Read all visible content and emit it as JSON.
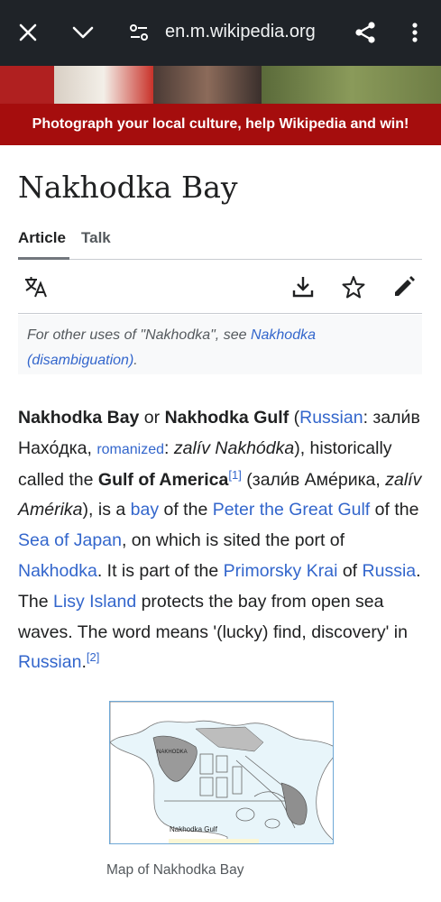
{
  "browser": {
    "url": "en.m.wikipedia.org",
    "icons": [
      "close-icon",
      "chevron-down-icon",
      "site-settings-icon",
      "share-icon",
      "more-vert-icon"
    ]
  },
  "banner": {
    "text": "Photograph your local culture, help Wikipedia and win!",
    "color": "#a50d0d"
  },
  "page": {
    "title": "Nakhodka Bay",
    "tabs": [
      {
        "label": "Article",
        "active": true
      },
      {
        "label": "Talk",
        "active": false
      }
    ],
    "actions": [
      "language-icon",
      "download-icon",
      "watch-star-icon",
      "edit-pencil-icon"
    ]
  },
  "hatnote": {
    "prefix": "For other uses of \"Nakhodka\", see ",
    "link": "Nakhodka (disambiguation)",
    "suffix": "."
  },
  "article": {
    "t01": "Nakhodka Bay",
    "t02": " or ",
    "t03": "Nakhodka Gulf",
    "t04": " (",
    "t05": "Russian",
    "t06": ": зали́в Нахо́дка, ",
    "t07": "romanized",
    "t08": ": ",
    "t09": "zalív Nakhódka",
    "t10": "), historically called the ",
    "t11": "Gulf of America",
    "t12": "[1]",
    "t13": " (зали́в Аме́рика, ",
    "t14": "zalív Amérika",
    "t15": "), is a ",
    "t16": "bay",
    "t17": " of the ",
    "t18": "Peter the Great Gulf",
    "t19": " of the ",
    "t20": "Sea of Japan",
    "t21": ", on which is sited the port of ",
    "t22": "Nakhodka",
    "t23": ". It is part of the ",
    "t24": "Primorsky Krai",
    "t25": " of ",
    "t26": "Russia",
    "t27": ". The ",
    "t28": "Lisy Island",
    "t29": " protects the bay from open sea waves. The word means '(lucky) find, discovery' in ",
    "t30": "Russian",
    "t31": ".",
    "t32": "[2]"
  },
  "figure": {
    "map_labels": [
      "NAKHODKA",
      "Nakhodka Gulf"
    ],
    "caption": "Map of Nakhodka Bay"
  }
}
